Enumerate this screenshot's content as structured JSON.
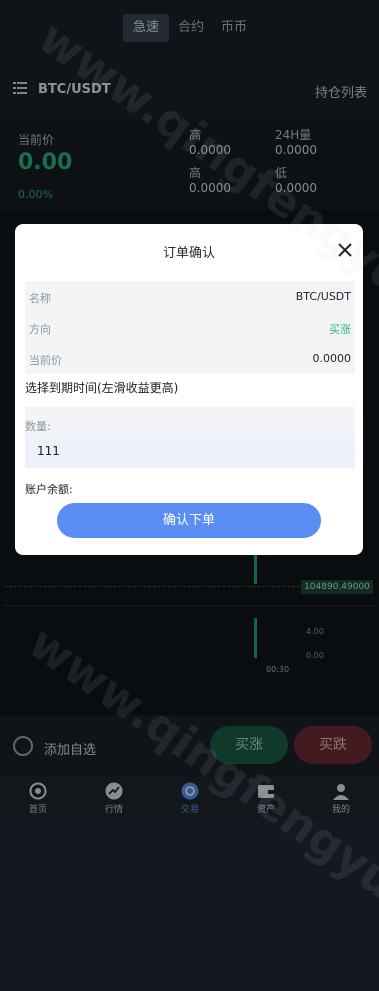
{
  "top_tabs": [
    "急速",
    "合约",
    "币币"
  ],
  "header": {
    "pair": "BTC/USDT",
    "positions_link": "持仓列表"
  },
  "stats": {
    "current_label": "当前价",
    "current_price": "0.00",
    "change_pct": "0.00%",
    "high_label": "高",
    "high_value": "0.0000",
    "high2_label": "高",
    "high2_value": "0.0000",
    "vol_label": "24H量",
    "vol_value": "0.0000",
    "low_label": "低",
    "low_value": "0.0000"
  },
  "chart": {
    "price_tag": "104890.49000",
    "vol_tick_1": "4.00",
    "vol_tick_2": "0.00",
    "time_tick": "00:30"
  },
  "action": {
    "fav_label": "添加自选",
    "buy_up": "买涨",
    "buy_down": "买跌"
  },
  "tabs": [
    "首页",
    "行情",
    "交易",
    "资产",
    "我的"
  ],
  "modal": {
    "title": "订单确认",
    "rows": [
      {
        "k": "名称",
        "v": "BTC/USDT"
      },
      {
        "k": "方向",
        "v": "买涨"
      },
      {
        "k": "当前价",
        "v": "0.0000"
      }
    ],
    "expiry_label": "选择到期时间(左滑收益更高)",
    "qty_label": "数量:",
    "qty_value": "111",
    "balance_label": "账户余额:",
    "confirm": "确认下单"
  },
  "colors": {
    "up": "#26b47a",
    "down": "#6b2a34",
    "accent": "#5b8ef5"
  },
  "watermark": "www.qingfengyuanma"
}
